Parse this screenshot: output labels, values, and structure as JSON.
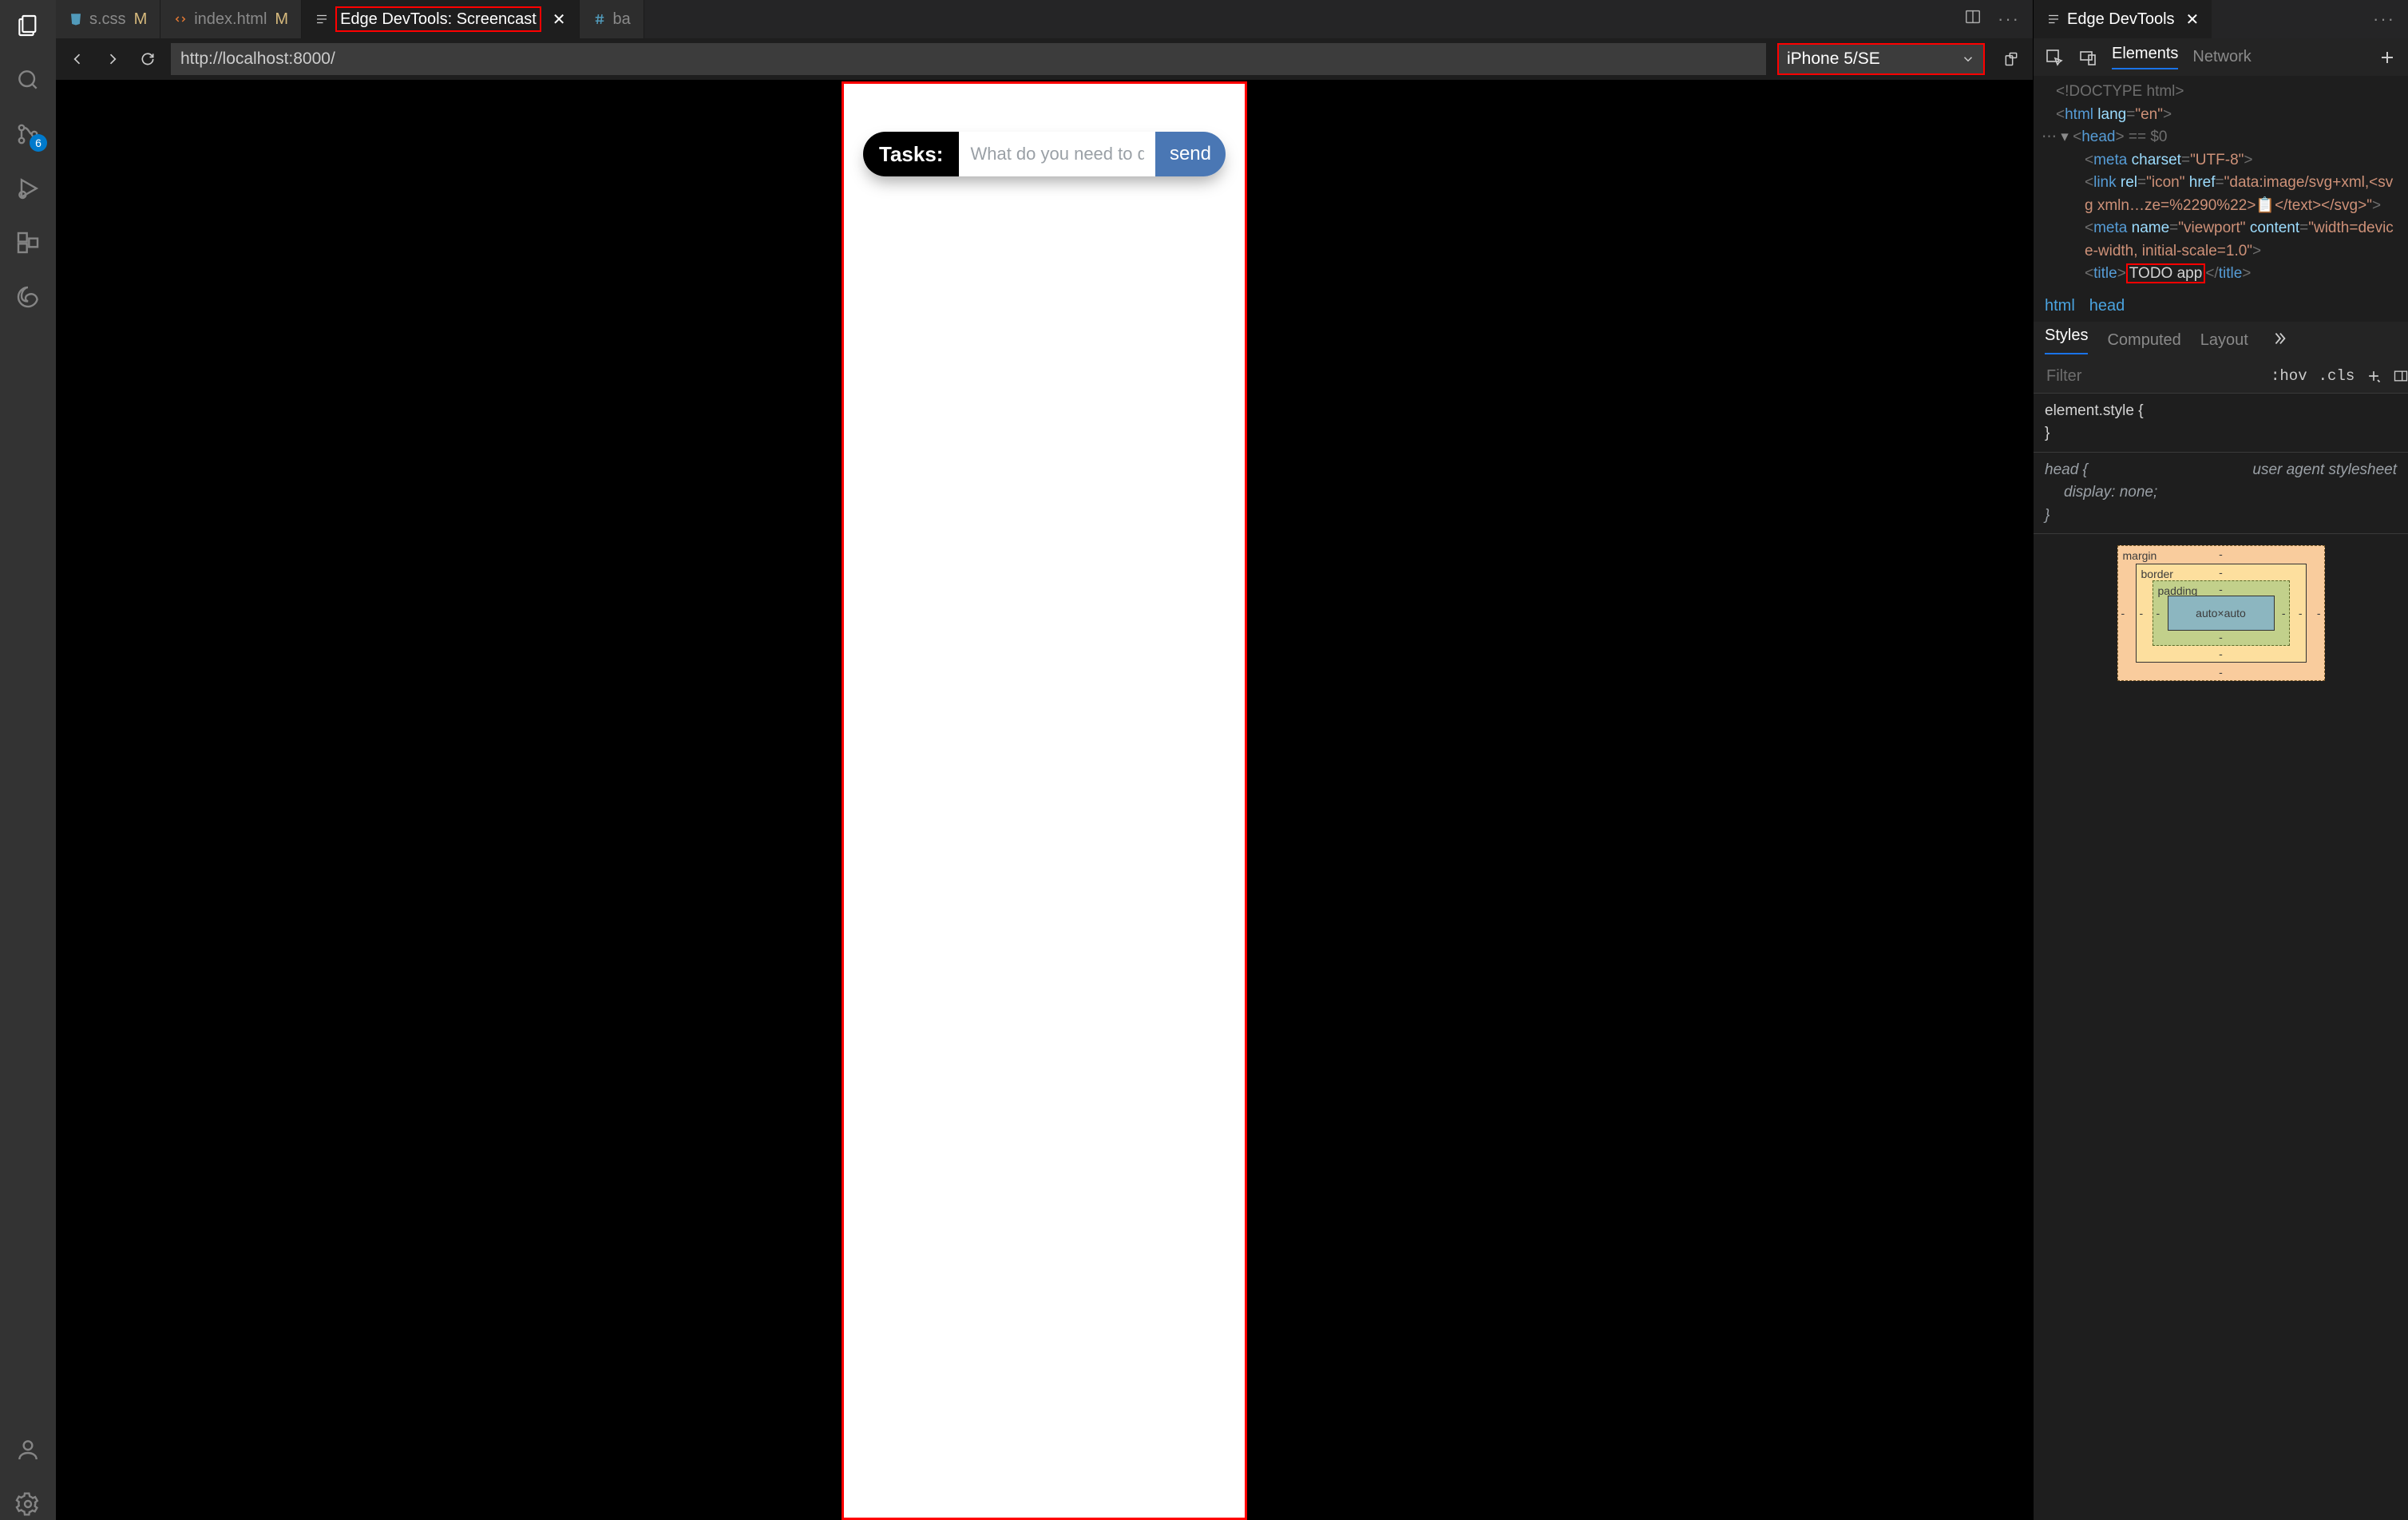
{
  "activity": {
    "scm_badge": "6"
  },
  "tabs": {
    "css": {
      "label": "s.css",
      "mod": "M"
    },
    "html": {
      "label": "index.html",
      "mod": "M"
    },
    "screencast": {
      "label": "Edge DevTools: Screencast"
    },
    "bas": {
      "label": "ba"
    }
  },
  "devtoolsTab": {
    "label": "Edge DevTools"
  },
  "browse": {
    "url": "http://localhost:8000/",
    "device": "iPhone 5/SE"
  },
  "mock": {
    "tasks_label": "Tasks:",
    "tasks_placeholder": "What do you need to do?",
    "send": "send"
  },
  "dtTabs": {
    "elements": "Elements",
    "network": "Network"
  },
  "dom": {
    "doctype": "<!DOCTYPE html>",
    "html_open": "html",
    "html_lang_attr": "lang",
    "html_lang_val": "\"en\"",
    "head": "head",
    "head_meta": "== $0",
    "meta_charset_attr": "charset",
    "meta_charset_val": "\"UTF-8\"",
    "link_rel_attr": "rel",
    "link_rel_val": "\"icon\"",
    "link_href_attr": "href",
    "link_href_val": "\"data:image/svg+xml,<svg xmln…ze=%2290%22>📋</text></svg>\"",
    "meta2_name_attr": "name",
    "meta2_name_val": "\"viewport\"",
    "meta2_content_attr": "content",
    "meta2_content_val": "\"width=device-width, initial-scale=1.0\"",
    "title_tag": "title",
    "title_text": "TODO app"
  },
  "crumbs": {
    "a": "html",
    "b": "head"
  },
  "subTabs": {
    "styles": "Styles",
    "computed": "Computed",
    "layout": "Layout"
  },
  "filter": {
    "placeholder": "Filter",
    "hov": ":hov",
    "cls": ".cls"
  },
  "css1": {
    "sel": "element.style {",
    "close": "}"
  },
  "css2": {
    "sel": "head {",
    "src": "user agent stylesheet",
    "prop": "display",
    "val": "none",
    "close": "}"
  },
  "box": {
    "margin": "margin",
    "border": "border",
    "padding": "padding",
    "content": "auto×auto",
    "dash": "-"
  }
}
